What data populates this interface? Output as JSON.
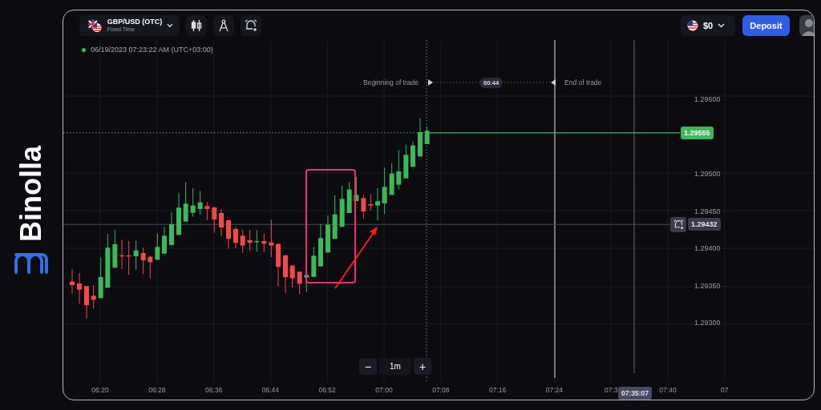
{
  "logo": {
    "text": "Binolla"
  },
  "toolbar": {
    "asset": {
      "name": "GBP/USD (OTC)",
      "mode": "Fixed Time"
    },
    "balance": "$0",
    "deposit_button": "Deposit"
  },
  "chart": {
    "timestamp": "06/19/2023 07:23:22 AM (UTC+03:00)",
    "trade_start_label": "Beginning of trade",
    "countdown": "00:44",
    "trade_end_label": "End of trade",
    "price_ticks": [
      "1.29600",
      "1.29500",
      "1.29450",
      "1.29400",
      "1.29350",
      "1.29300"
    ],
    "current_price": "1.29555",
    "alert_price": "1.29432",
    "time_ticks": [
      "06:20",
      "06:28",
      "06:36",
      "06:44",
      "06:52",
      "07:00",
      "07:08",
      "07:16",
      "07:24",
      "07:3",
      "07:40",
      "07"
    ],
    "current_time": "07:35:07",
    "timeframe": {
      "minus": "−",
      "value": "1m",
      "plus": "+"
    }
  }
}
